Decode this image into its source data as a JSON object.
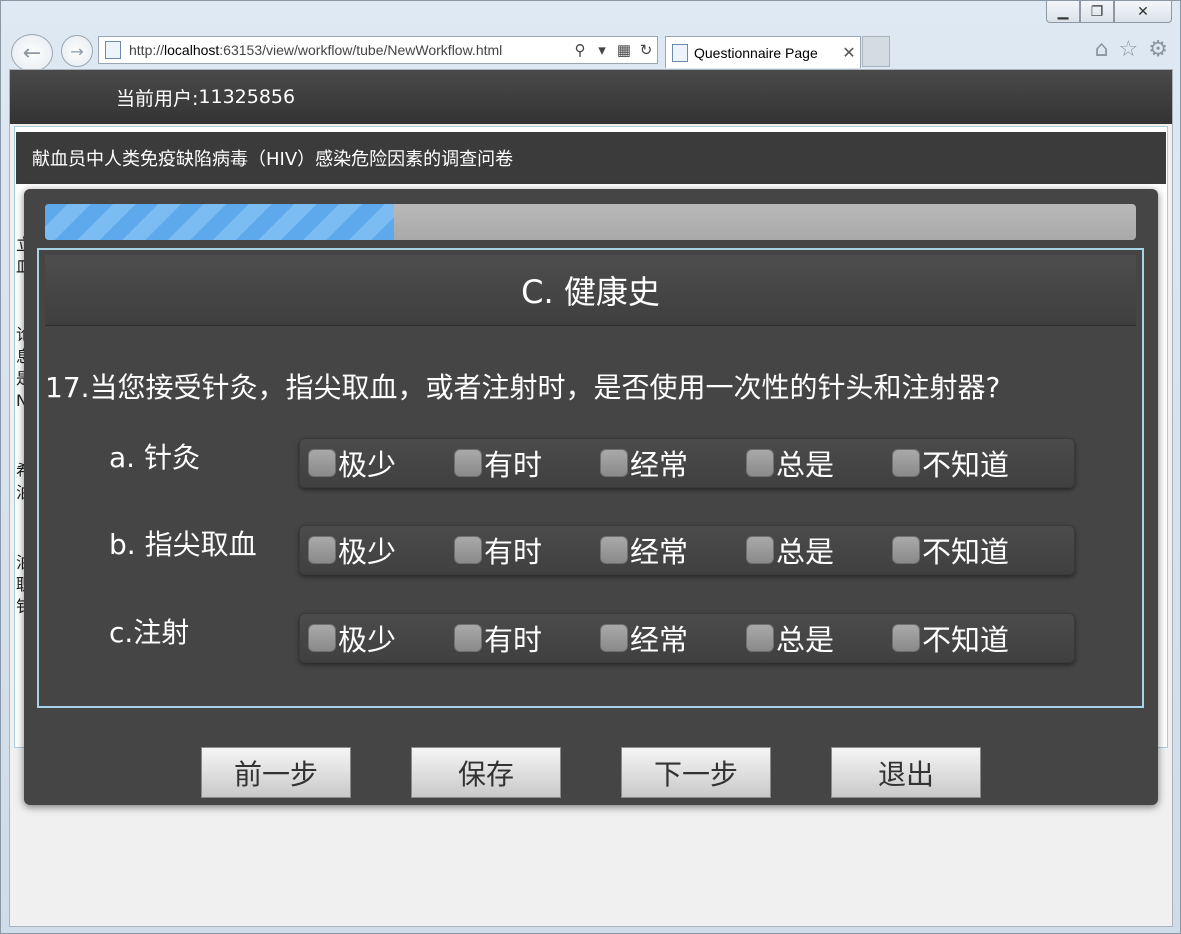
{
  "browser": {
    "url_prefix": "http://",
    "url_host": "localhost",
    "url_rest": ":63153/view/workflow/tube/NewWorkflow.html",
    "tab_title": "Questionnaire Page"
  },
  "header": {
    "current_user_label": "当前用户:",
    "current_user_id": "11325856"
  },
  "survey": {
    "title": "献血员中人类免疫缺陷病毒（HIV）感染危险因素的调查问卷"
  },
  "background_fragments": [
    "立",
    "皿",
    "论",
    "息",
    "是",
    "N",
    "希",
    "泊",
    "泊",
    "职",
    "钅"
  ],
  "progress": {
    "fraction": 0.32
  },
  "section": {
    "title": "C. 健康史"
  },
  "question": {
    "number": "17.",
    "text": "当您接受针灸，指尖取血，或者注射时，是否使用一次性的针头和注射器?",
    "sub_items": [
      {
        "label": "a. 针灸"
      },
      {
        "label": "b. 指尖取血"
      },
      {
        "label": "c.注射"
      }
    ],
    "options": [
      "极少",
      "有时",
      "经常",
      "总是",
      "不知道"
    ]
  },
  "buttons": {
    "prev": "前一步",
    "save": "保存",
    "next": "下一步",
    "exit": "退出"
  },
  "colors": {
    "modal_bg": "#454545",
    "progress_fill": "#5ea9ec",
    "section_border": "#a6d3e6"
  }
}
